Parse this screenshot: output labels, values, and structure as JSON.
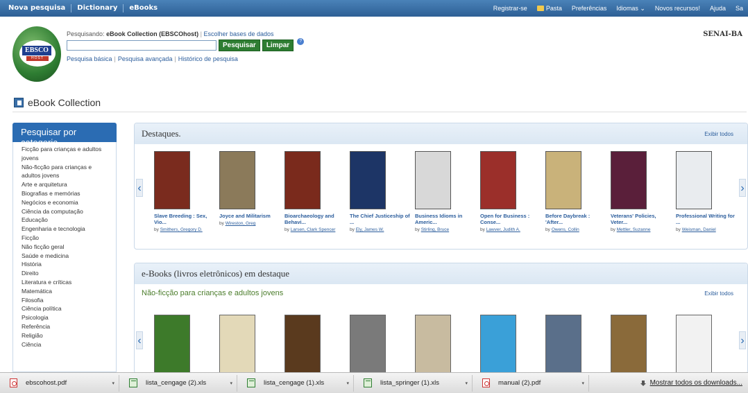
{
  "topbar": {
    "nav": [
      "Nova pesquisa",
      "Dictionary",
      "eBooks"
    ],
    "right": [
      "Registrar-se",
      "Pasta",
      "Preferências",
      "Idiomas ⌄",
      "Novos recursos!",
      "Ajuda",
      "Sa"
    ]
  },
  "logo": {
    "line1": "EBSCO",
    "line2": "HOST"
  },
  "search": {
    "label_prefix": "Pesquisando:",
    "database": "eBook Collection (EBSCOhost)",
    "choose_db": "Escolher bases de dados",
    "search_btn": "Pesquisar",
    "clear_btn": "Limpar",
    "help": "?",
    "links": [
      "Pesquisa básica",
      "Pesquisa avançada",
      "Histórico de pesquisa"
    ]
  },
  "institution": "SENAI-BA",
  "collection_title": "eBook Collection",
  "sidebar": {
    "heading": "Pesquisar por categoria",
    "items": [
      "Ficção para crianças e adultos jovens",
      "Não-ficção para crianças e adultos jovens",
      "Arte e arquitetura",
      "Biografias e memórias",
      "Negócios e economia",
      "Ciência da computação",
      "Educação",
      "Engenharia e tecnologia",
      "Ficção",
      "Não ficção geral",
      "Saúde e medicina",
      "História",
      "Direito",
      "Literatura e críticas",
      "Matemática",
      "Filosofia",
      "Ciência política",
      "Psicologia",
      "Referência",
      "Religião",
      "Ciência"
    ]
  },
  "featured": {
    "title": "Destaques.",
    "view_all": "Exibir todos",
    "books": [
      {
        "title": "Slave Breeding : Sex, Vio...",
        "by": "by",
        "author": "Smithers, Gregory D.",
        "color": "#7a2b1e"
      },
      {
        "title": "Joyce and Militarism",
        "by": "by",
        "author": "Wireston, Greg",
        "color": "#8b7a5a"
      },
      {
        "title": "Bioarchaeology and Behavi...",
        "by": "by",
        "author": "Larsen, Clark Spencer",
        "color": "#7a2a1c"
      },
      {
        "title": "The Chief Justiceship of ...",
        "by": "by",
        "author": "Ely, James W.",
        "color": "#1d3566"
      },
      {
        "title": "Business Idioms in Americ...",
        "by": "by",
        "author": "Stirling, Bruce",
        "color": "#d8d8d8"
      },
      {
        "title": "Open for Business : Conse...",
        "by": "by",
        "author": "Lawver, Judith A.",
        "color": "#9b2f2a"
      },
      {
        "title": "Before Daybreak : 'After...",
        "by": "by",
        "author": "Owens, Collin",
        "color": "#c9b27a"
      },
      {
        "title": "Veterans' Policies, Veter...",
        "by": "by",
        "author": "Mettler, Suzanne",
        "color": "#5a1f3a"
      },
      {
        "title": "Professional Writing for ...",
        "by": "by",
        "author": "Weisman, Daniel",
        "color": "#e9ecef"
      }
    ]
  },
  "ebooks": {
    "title": "e-Books (livros eletrônicos) em destaque",
    "subtitle": "Não-ficção para crianças e adultos jovens",
    "view_all": "Exibir todos",
    "covers": [
      "#3d7a2a",
      "#e3d9b8",
      "#5a3a1e",
      "#7a7a7a",
      "#c8bba0",
      "#3aa0d8",
      "#5a6f8a",
      "#8a6a3a",
      "#f2f2f2"
    ]
  },
  "downloads": {
    "items": [
      {
        "name": "ebscohost.pdf",
        "type": "pdf"
      },
      {
        "name": "lista_cengage (2).xls",
        "type": "xls"
      },
      {
        "name": "lista_cengage (1).xls",
        "type": "xls"
      },
      {
        "name": "lista_springer (1).xls",
        "type": "xls"
      },
      {
        "name": "manual (2).pdf",
        "type": "pdf"
      }
    ],
    "show_all": "Mostrar todos os downloads..."
  }
}
